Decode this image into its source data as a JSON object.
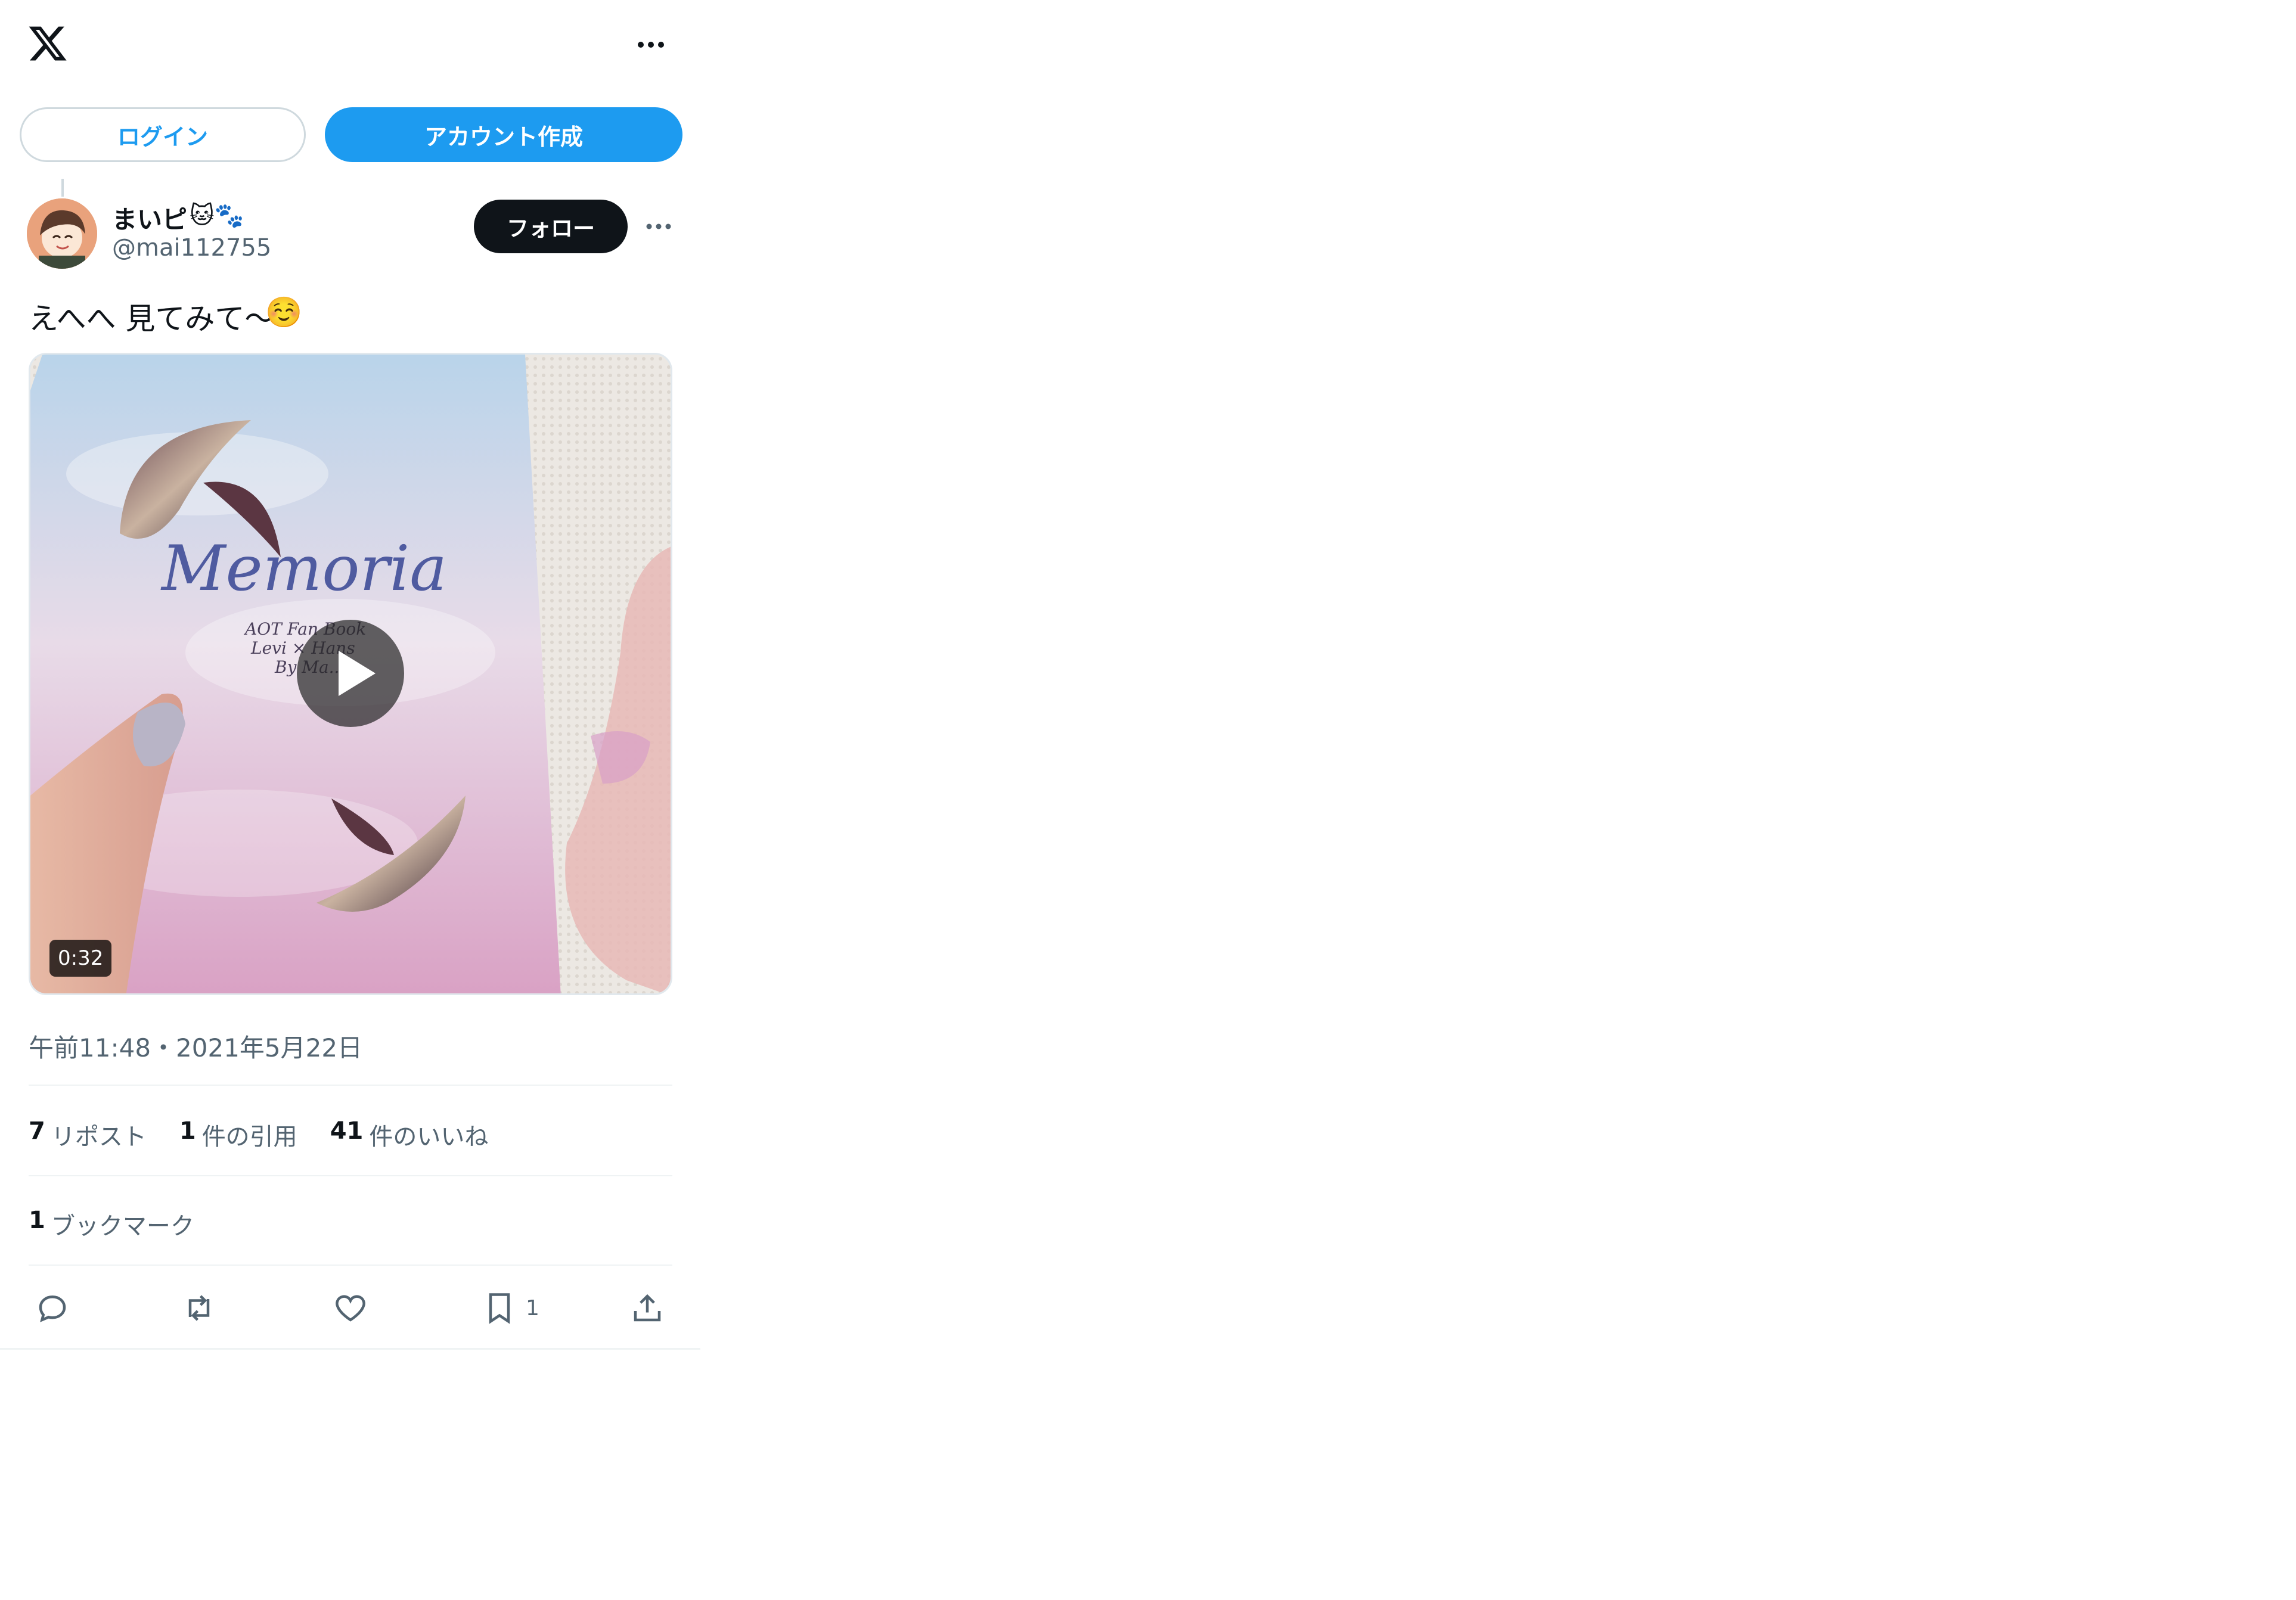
{
  "header": {
    "logo_icon": "x-logo-icon",
    "more_icon": "more-horizontal-icon"
  },
  "auth": {
    "login_label": "ログイン",
    "signup_label": "アカウント作成"
  },
  "post": {
    "author_name": "まいピ",
    "author_emoji": "🐱🐾",
    "author_handle": "@mai112755",
    "follow_label": "フォロー",
    "text": "えへへ 見てみて〜",
    "text_emoji": "☺️",
    "media": {
      "duration": "0:32",
      "card_title": "Memoria",
      "card_subtitle": "AOT Fan Book",
      "card_line2": "Levi × Hans",
      "card_line3": "By Ma.."
    },
    "timestamp": "午前11:48・2021年5月22日",
    "stats": [
      {
        "count": "7",
        "label": "リポスト"
      },
      {
        "count": "1",
        "label": "件の引用"
      },
      {
        "count": "41",
        "label": "件のいいね"
      }
    ],
    "bookmarks": {
      "count": "1",
      "label": "ブックマーク"
    },
    "actions": {
      "bookmark_count": "1"
    }
  },
  "colors": {
    "accent": "#1d9bf0",
    "text_primary": "#0f1419",
    "text_secondary": "#536471",
    "divider": "#eff3f4"
  }
}
